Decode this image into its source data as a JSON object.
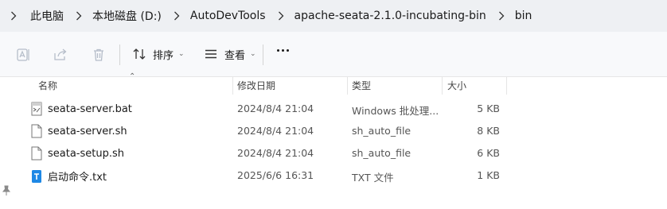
{
  "breadcrumb": {
    "items": [
      "此电脑",
      "本地磁盘 (D:)",
      "AutoDevTools",
      "apache-seata-2.1.0-incubating-bin",
      "bin"
    ]
  },
  "toolbar": {
    "sort_label": "排序",
    "view_label": "查看",
    "icons": [
      "rename-icon",
      "share-icon",
      "delete-icon",
      "sort-icon",
      "view-icon",
      "more-icon"
    ]
  },
  "columns": {
    "name": "名称",
    "date": "修改日期",
    "type": "类型",
    "size": "大小",
    "sorted_by": "名称"
  },
  "files": [
    {
      "name": "seata-server.bat",
      "date": "2024/8/4 21:04",
      "type": "Windows 批处理...",
      "size": "5 KB",
      "icon": "batch-file-icon"
    },
    {
      "name": "seata-server.sh",
      "date": "2024/8/4 21:04",
      "type": "sh_auto_file",
      "size": "8 KB",
      "icon": "file-icon"
    },
    {
      "name": "seata-setup.sh",
      "date": "2024/8/4 21:04",
      "type": "sh_auto_file",
      "size": "6 KB",
      "icon": "file-icon"
    },
    {
      "name": "启动命令.txt",
      "date": "2025/6/6 16:31",
      "type": "TXT 文件",
      "size": "1 KB",
      "icon": "text-file-icon"
    }
  ],
  "colors": {
    "breadcrumb_bg": "#eef0f3",
    "toolbar_bg": "#f8f9fb",
    "content_bg": "#ffffff",
    "txt_icon_blue": "#1e88e5"
  }
}
